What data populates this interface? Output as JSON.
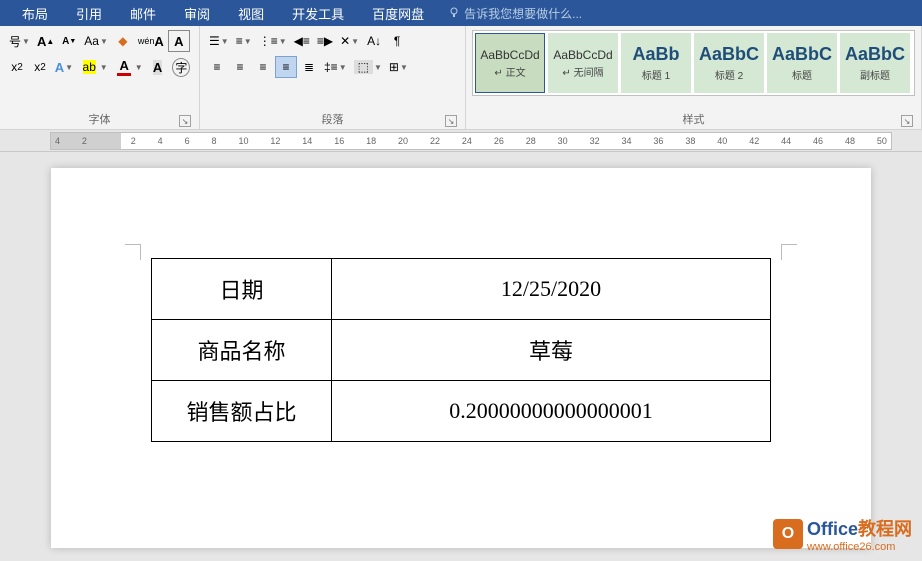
{
  "menubar": {
    "items": [
      "布局",
      "引用",
      "邮件",
      "审阅",
      "视图",
      "开发工具",
      "百度网盘"
    ],
    "tell_me": "告诉我您想要做什么..."
  },
  "ribbon": {
    "font_label": "字体",
    "para_label": "段落",
    "style_label": "样式",
    "styles": [
      {
        "preview": "AaBbCcDd",
        "name": "↵ 正文",
        "big": false
      },
      {
        "preview": "AaBbCcDd",
        "name": "↵ 无间隔",
        "big": false
      },
      {
        "preview": "AaBb",
        "name": "标题 1",
        "big": true
      },
      {
        "preview": "AaBbC",
        "name": "标题 2",
        "big": true
      },
      {
        "preview": "AaBbC",
        "name": "标题",
        "big": true
      },
      {
        "preview": "AaBbC",
        "name": "副标题",
        "big": true
      }
    ]
  },
  "ruler": {
    "numbers": [
      "4",
      "2",
      "",
      "2",
      "4",
      "6",
      "8",
      "10",
      "12",
      "14",
      "16",
      "18",
      "20",
      "22",
      "24",
      "26",
      "28",
      "30",
      "32",
      "34",
      "36",
      "38",
      "40",
      "42",
      "44",
      "46",
      "48",
      "50"
    ]
  },
  "document": {
    "table": [
      {
        "label": "日期",
        "value": "12/25/2020"
      },
      {
        "label": "商品名称",
        "value": "草莓"
      },
      {
        "label": "销售额占比",
        "value": "0.20000000000000001"
      }
    ]
  },
  "watermark": {
    "brand1": "Office",
    "brand2": "教程网",
    "url": "www.office26.com"
  }
}
